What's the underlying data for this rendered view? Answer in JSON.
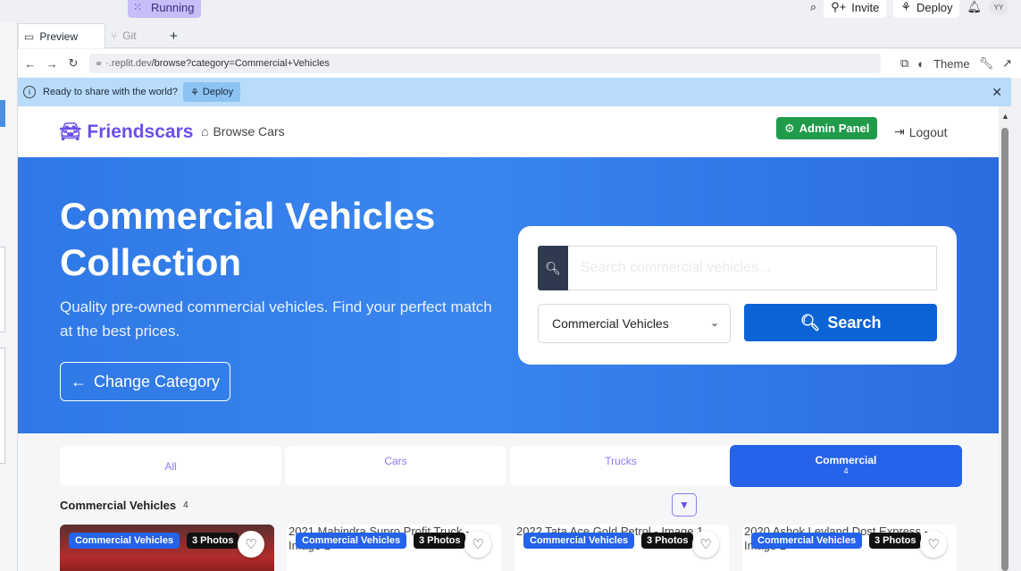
{
  "ide": {
    "status": "Running",
    "invite_label": "Invite",
    "deploy_label": "Deploy",
    "avatar": "YY"
  },
  "tabs": [
    {
      "label": "Preview",
      "icon": "monitor-icon"
    },
    {
      "label": "Git",
      "icon": "git-icon"
    }
  ],
  "address": {
    "host": "·.replit.dev",
    "path": "/browse?category=Commercial+Vehicles",
    "theme_label": "Theme"
  },
  "banner": {
    "message": "Ready to share with the world?",
    "deploy_label": "Deploy"
  },
  "navbar": {
    "brand": "Friendscars",
    "browse": "Browse Cars",
    "admin": "Admin Panel",
    "logout": "Logout"
  },
  "hero": {
    "title": "Commercial Vehicles Collection",
    "subtitle": "Quality pre-owned commercial vehicles. Find your perfect match at the best prices.",
    "change_category": "Change Category",
    "search_placeholder": "Search commercial vehicles...",
    "category_selected": "Commercial Vehicles",
    "search_button": "Search"
  },
  "category_tabs": [
    {
      "label": "All",
      "count": ""
    },
    {
      "label": "Cars",
      "count": ""
    },
    {
      "label": "Trucks",
      "count": ""
    },
    {
      "label": "Commercial",
      "count": "4"
    }
  ],
  "section": {
    "title": "Commercial Vehicles",
    "count": "4"
  },
  "cards": [
    {
      "alt": "",
      "category": "Commercial Vehicles",
      "photos": "3 Photos"
    },
    {
      "alt": "2021 Mahindra Supro Profit Truck - Image 1",
      "category": "Commercial Vehicles",
      "photos": "3 Photos"
    },
    {
      "alt": "2022 Tata Ace Gold Petrol - Image 1",
      "category": "Commercial Vehicles",
      "photos": "3 Photos"
    },
    {
      "alt": "2020 Ashok Leyland Dost Express - Image 1",
      "category": "Commercial Vehicles",
      "photos": "3 Photos"
    }
  ],
  "colors": {
    "brand": "#6c4fe8",
    "hero": "#2f78e6",
    "admin": "#1f9b4a",
    "active_tab": "#2563eb"
  }
}
